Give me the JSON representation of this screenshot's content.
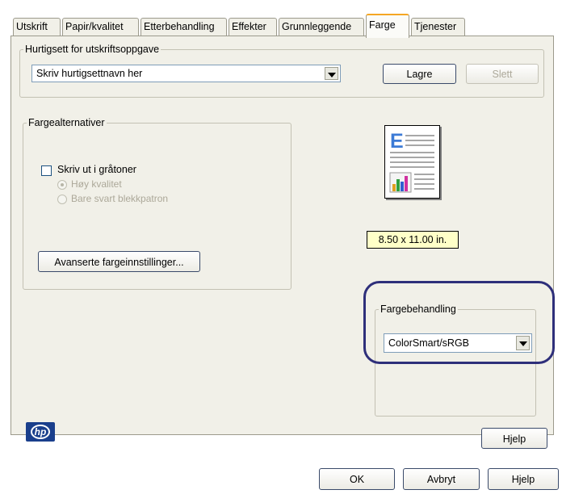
{
  "tabs": [
    {
      "label": "Utskrift"
    },
    {
      "label": "Papir/kvalitet"
    },
    {
      "label": "Etterbehandling"
    },
    {
      "label": "Effekter"
    },
    {
      "label": "Grunnleggende"
    },
    {
      "label": "Farge",
      "active": true
    },
    {
      "label": "Tjenester"
    }
  ],
  "quickset": {
    "legend": "Hurtigsett for utskriftsoppgave",
    "value": "Skriv hurtigsettnavn her",
    "save_label": "Lagre",
    "delete_label": "Slett"
  },
  "color_options": {
    "legend": "Fargealternativer",
    "grayscale_label": "Skriv ut i gråtoner",
    "grayscale_checked": false,
    "high_quality_label": "Høy kvalitet",
    "black_cartridge_label": "Bare svart blekkpatron",
    "advanced_label": "Avanserte fargeinnstillinger..."
  },
  "preview": {
    "paper_size": "8.50 x 11.00 in.",
    "doc_letter": "E"
  },
  "color_management": {
    "legend": "Fargebehandling",
    "value": "ColorSmart/sRGB",
    "highlight_color": "#2e2f7a"
  },
  "brand": {
    "logo_text": "hp"
  },
  "buttons": {
    "help_panel": "Hjelp",
    "ok": "OK",
    "cancel": "Avbryt",
    "help": "Hjelp"
  }
}
